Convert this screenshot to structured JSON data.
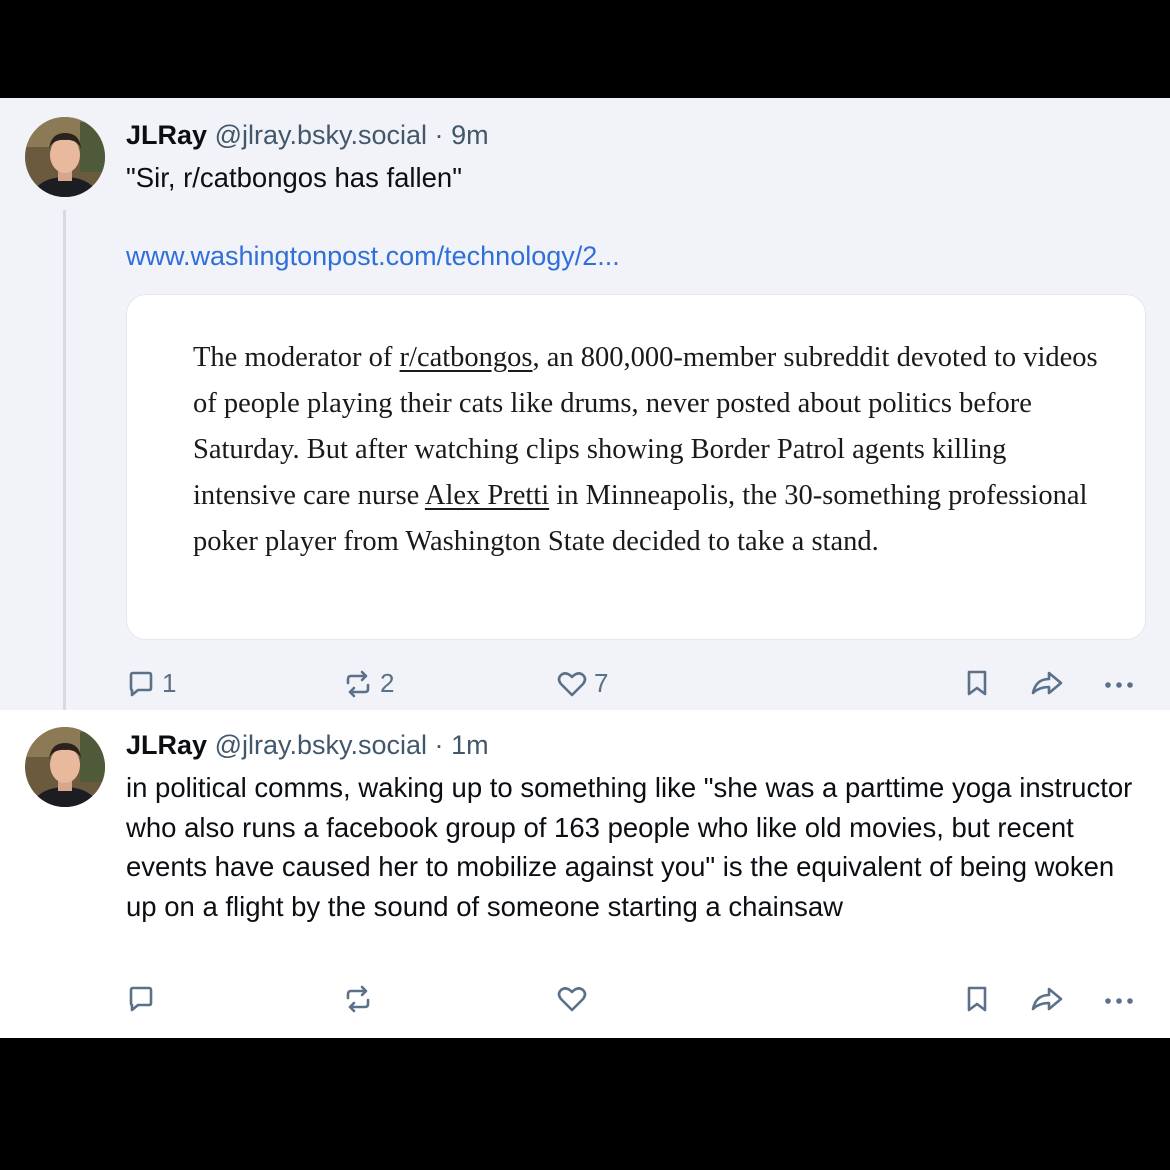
{
  "posts": [
    {
      "author_name": "JLRay",
      "handle": "@jlray.bsky.social",
      "time": "9m",
      "text": "\"Sir, r/catbongos has fallen\"",
      "link_text": "www.washingtonpost.com/technology/2...",
      "quote": {
        "part1": "The moderator of ",
        "link1": "r/catbongos",
        "part2": ", an 800,000-member subreddit devoted to videos of people playing their cats like drums, never posted about politics before Saturday. But after watching clips showing Border Patrol agents killing intensive care nurse ",
        "link2": "Alex Pretti",
        "part3": " in Minneapolis, the 30-something professional poker player from Washington State decided to take a stand."
      },
      "replies": "1",
      "reposts": "2",
      "likes": "7"
    },
    {
      "author_name": "JLRay",
      "handle": "@jlray.bsky.social",
      "time": "1m",
      "text": "in political comms, waking up to something like \"she was a parttime yoga instructor who also runs a facebook group of 163 people who like old movies, but recent events have caused her to mobilize against you\" is the equivalent of being woken up on a flight by the sound of someone starting a chainsaw"
    }
  ],
  "icons": [
    "reply-icon",
    "repost-icon",
    "like-icon",
    "bookmark-icon",
    "share-icon",
    "more-icon"
  ],
  "colors": {
    "link": "#2f6fda",
    "action": "#5b7089",
    "thread_bg": "#f1f3f8"
  }
}
